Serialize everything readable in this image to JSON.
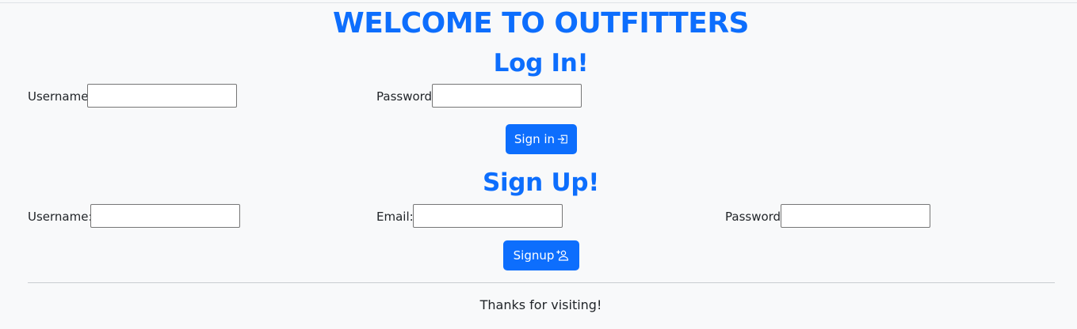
{
  "header": {
    "title": "WELCOME TO OUTFITTERS"
  },
  "login": {
    "heading": "Log In!",
    "username_label": "Username",
    "username_value": "",
    "password_label": "Password",
    "password_value": "",
    "submit_label": "Sign in",
    "submit_icon": "box-arrow-in-right-icon"
  },
  "signup": {
    "heading": "Sign Up!",
    "username_label": "Username:",
    "username_value": "",
    "email_label": "Email:",
    "email_value": "",
    "password_label": "Password",
    "password_value": "",
    "submit_label": "Signup",
    "submit_icon": "person-add-icon"
  },
  "footer": {
    "text": "Thanks for visiting!"
  },
  "colors": {
    "accent": "#0d6efd",
    "background": "#f8f9fa",
    "text": "#212529"
  }
}
